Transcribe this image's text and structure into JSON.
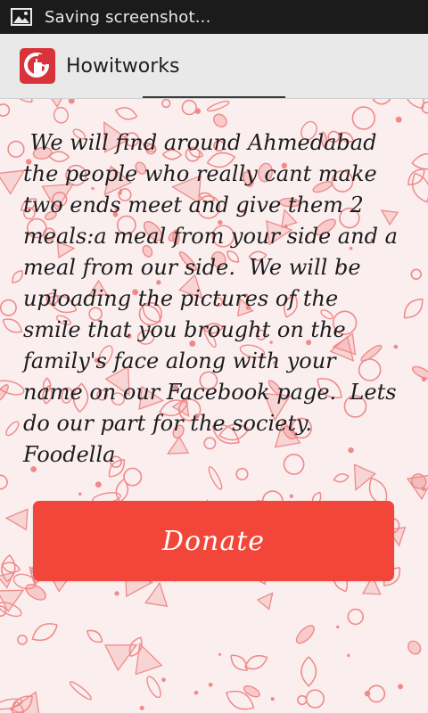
{
  "status_bar": {
    "notification_icon": "image-icon",
    "text": "Saving screenshot..."
  },
  "action_bar": {
    "app_icon": "foodella-logo-icon",
    "title": "Howitworks"
  },
  "content": {
    "message": " We will find around Ahmedabad\nthe people who really cant make\ntwo ends meet and give them 2\nmeals:a meal from your side and a\nmeal from our side.  We will be\nuploading the pictures of the\nsmile that you brought on the\nfamily's face along with your\nname on our Facebook page.  Lets\ndo our part for the society.\nFoodella",
    "donate_label": "Donate"
  },
  "colors": {
    "status_bar": "#1b1b1b",
    "action_bar": "#e9e9e9",
    "accent": "#f2463a",
    "app_icon": "#d8333a",
    "pattern": "#f08a8a",
    "background": "#fbeeee"
  }
}
